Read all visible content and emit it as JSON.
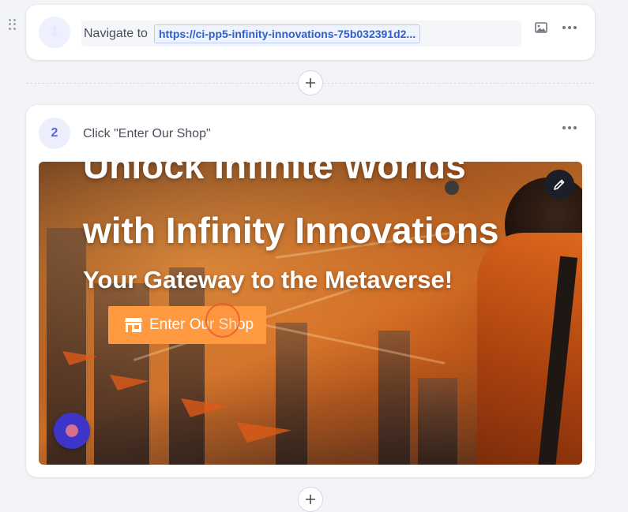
{
  "steps": [
    {
      "number": "1",
      "action_label": "Navigate to",
      "url": "https://ci-pp5-infinity-innovations-75b032391d2..."
    },
    {
      "number": "2",
      "title": "Click \"Enter Our Shop\"",
      "screenshot": {
        "headline_line1": "Unlock Infinite Worlds",
        "headline_line2": "with Infinity Innovations",
        "subheadline": "Your Gateway to the Metaverse!",
        "cta_label": "Enter Our Shop"
      }
    }
  ],
  "icons": {
    "drag": "drag-handle-icon",
    "image": "image-icon",
    "more": "more-horizontal-icon",
    "add": "plus-icon",
    "edit": "pencil-icon",
    "shop": "store-icon",
    "record": "record-icon"
  },
  "colors": {
    "accent": "#5a63d8",
    "url_text": "#2f5fc9",
    "cta": "#ff9a40",
    "record_button": "#3c35c8"
  }
}
